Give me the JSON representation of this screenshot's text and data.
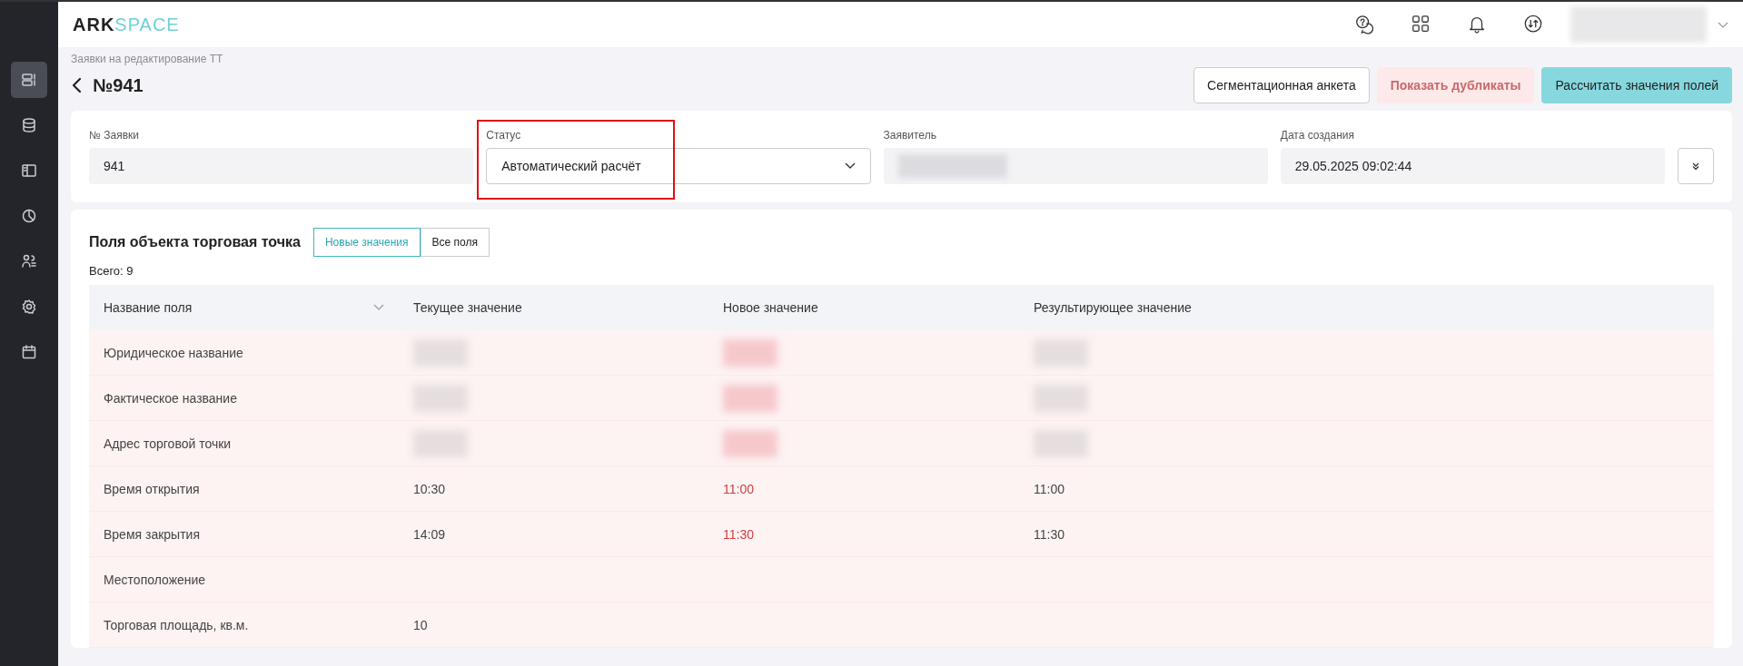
{
  "header": {
    "logo_dark": "ARK",
    "logo_light": "SPACE"
  },
  "breadcrumb": "Заявки на редактирование ТТ",
  "title": "№941",
  "sidebar": {
    "items": [
      {
        "selected": true
      },
      {
        "selected": false
      },
      {
        "selected": false
      },
      {
        "selected": false
      },
      {
        "selected": false
      },
      {
        "selected": false
      },
      {
        "selected": false
      }
    ]
  },
  "actions": [
    {
      "label": "Сегментационная анкета",
      "kind": "outline"
    },
    {
      "label": "Показать дубликаты",
      "kind": "danger"
    },
    {
      "label": "Рассчитать значения полей",
      "kind": "primary"
    }
  ],
  "form": {
    "fields": [
      {
        "label": "№ Заявки",
        "kind": "text",
        "value": "941",
        "highlighted": false
      },
      {
        "label": "Статус",
        "kind": "select",
        "value": "Автоматический расчёт",
        "highlighted": true
      },
      {
        "label": "Заявитель",
        "kind": "redacted",
        "highlighted": false
      },
      {
        "label": "Дата создания",
        "kind": "text",
        "value": "29.05.2025 09:02:44",
        "highlighted": false
      }
    ]
  },
  "fields_section": {
    "title": "Поля объекта торговая точка",
    "tabs": [
      {
        "label": "Новые значения",
        "selected": true
      },
      {
        "label": "Все поля",
        "selected": false
      }
    ],
    "total": "Всего: 9",
    "columns": [
      "Название поля",
      "Текущее значение",
      "Новое значение",
      "Результирующее значение"
    ],
    "rows": [
      {
        "name": "Юридическое название",
        "redacted": true
      },
      {
        "name": "Фактическое название",
        "redacted": true
      },
      {
        "name": "Адрес торговой точки",
        "redacted": true
      },
      {
        "name": "Время открытия",
        "redacted": false,
        "current": "10:30",
        "new": "11:00",
        "result": "11:00"
      },
      {
        "name": "Время закрытия",
        "redacted": false,
        "current": "14:09",
        "new": "11:30",
        "result": "11:30"
      },
      {
        "name": "Местоположение",
        "redacted": false
      },
      {
        "name": "Торговая площадь, кв.м.",
        "redacted": false,
        "current": "10"
      }
    ]
  }
}
